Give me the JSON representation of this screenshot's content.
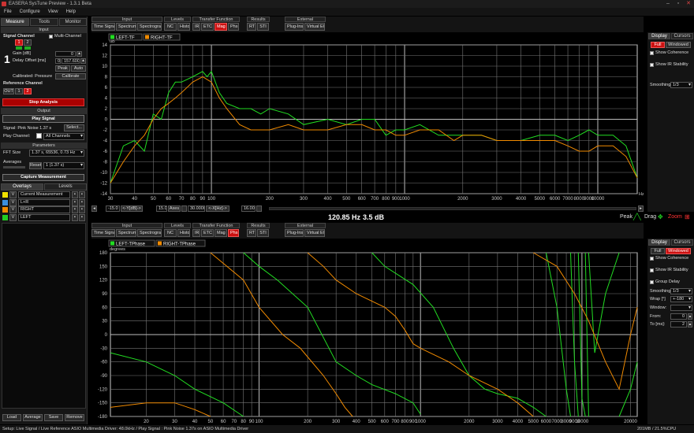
{
  "title": "EASERA SysTune Preview - 1.3.1 Beta",
  "menu": [
    "File",
    "Configure",
    "View",
    "Help"
  ],
  "left": {
    "tabs": [
      "Measure",
      "Tools",
      "Monitor"
    ],
    "input_header": "Input",
    "signal_channel": "Signal Channel",
    "multi_channel": "Multi-Channel",
    "ch1": "1",
    "ch2": "2",
    "big_channel": "1",
    "gain_label": "Gain [dB]",
    "gain_value": "0",
    "delay_label": "Delay Offset [ms]",
    "delay_value": "0",
    "delay_value2": "157.600",
    "peak": "Peak",
    "auto": "Auto",
    "calibrated": "Calibrated: Pressure",
    "calibrate": "Calibrate",
    "reference_channel": "Reference Channel",
    "ref_out": "OUT",
    "ref1": "1",
    "ref2": "2",
    "stop_analysis": "Stop Analysis",
    "output_header": "Output",
    "play_signal": "Play Signal",
    "signal_text": "Signal:  Pink Noise 1.37 s",
    "select": "Select...",
    "play_channel": "Play Channel:",
    "play_channel_value": "All Channels",
    "parameters_header": "Parameters",
    "fft_size_label": "FFT Size",
    "fft_size_value": "1.37 s, 65536, 0.73 Hz",
    "averages_label": "Averages",
    "reset": "Reset",
    "averages_value": "1 (1.37 s)",
    "capture": "Capture Measurement",
    "overlays_tab": "Overlays",
    "levels_tab": "Levels",
    "overlays": [
      {
        "v": "V",
        "name": "Current Measurement",
        "color": "#f0e000"
      },
      {
        "v": "V",
        "name": "L+R",
        "color": "#3a8fe0"
      },
      {
        "v": "V",
        "name": "RIGHT",
        "color": "#f08a00"
      },
      {
        "v": "V",
        "name": "LEFT",
        "color": "#22cc22"
      }
    ],
    "bottom_buttons": [
      "Load",
      "Average",
      "Save",
      "Remove"
    ]
  },
  "toolbar1": {
    "groups": [
      {
        "title": "Input",
        "buttons": [
          "Time Signal",
          "Spectrum",
          "Spectrogram"
        ]
      },
      {
        "title": "Levels",
        "buttons": [
          "NC",
          "Histo"
        ]
      },
      {
        "title": "Transfer Function",
        "buttons": [
          "IR",
          "ETC",
          "Mag",
          "Phs"
        ]
      },
      {
        "title": "Results",
        "buttons": [
          "RT",
          "STI"
        ]
      },
      {
        "title": "External",
        "buttons": [
          "Plug-Ins",
          "Virtual EQ"
        ]
      }
    ],
    "active": "Mag"
  },
  "toolbar2": {
    "active": "Phs"
  },
  "graph1": {
    "legend": [
      {
        "name": "LEFT-TF",
        "color": "#22dd22"
      },
      {
        "name": "RIGHT-TF",
        "color": "#f08a00"
      }
    ],
    "unit": "dB",
    "x_unit": "Hz",
    "controls": [
      "-15.0",
      "<-Y[dB]->",
      "15.0",
      "Axes",
      "",
      "30.00000",
      "<-X[Hz]->",
      "16.00k",
      ""
    ],
    "readout_freq": "120.85 Hz",
    "readout_level": "3.5 dB",
    "peak": "Peak",
    "drag": "Drag",
    "zoom": "Zoom"
  },
  "graph2": {
    "legend": [
      {
        "name": "LEFT-TPhase",
        "color": "#22dd22"
      },
      {
        "name": "RIGHT-TPhase",
        "color": "#f08a00"
      }
    ],
    "unit": "degrees"
  },
  "right1": {
    "tabs": [
      "Display",
      "Cursors"
    ],
    "full": "Full",
    "windowed": "Windowed",
    "show_coherence": "Show Coherence",
    "show_ir_stability": "Show IR Stability",
    "smoothing_label": "Smoothing",
    "smoothing_value": "1/3"
  },
  "right2": {
    "tabs": [
      "Display",
      "Cursors"
    ],
    "full": "Full",
    "windowed": "Windowed",
    "show_coherence": "Show Coherence",
    "show_ir_stability": "Show IR Stability",
    "group_delay": "Group Delay",
    "smoothing_label": "Smoothing",
    "smoothing_value": "1/3",
    "wrap_label": "Wrap [°]",
    "wrap_value": "+-180",
    "window_label": "Window:",
    "from_label": "From:",
    "from_value": "0",
    "to_label": "To [ms]:",
    "to_value": "2"
  },
  "status": "Setup: Live Signal / Live Reference ASIO Multimedia Driver: 48.0kHz / Play Signal : Pink Noise  1.37s on ASIO Multimedia Driver",
  "status_right": "201MB / 21.5%CPU",
  "colors": {
    "left": "#22dd22",
    "right": "#f08a00",
    "active_red": "#cc1111"
  },
  "chart_data": [
    {
      "type": "line",
      "x_scale": "log",
      "xlim": [
        30,
        16000
      ],
      "ylim": [
        -14,
        14
      ],
      "ylabel": "dB",
      "xlabel": "Hz",
      "x_ticks": [
        30,
        40,
        50,
        60,
        70,
        80,
        90,
        100,
        200,
        300,
        400,
        500,
        600,
        700,
        800,
        900,
        1000,
        2000,
        3000,
        4000,
        5000,
        6000,
        7000,
        8000,
        9000,
        10000
      ],
      "x_tick_labels": [
        "30",
        "40",
        "50",
        "60",
        "70",
        "80",
        "90",
        "100",
        "200",
        "300",
        "400",
        "500",
        "600",
        "700",
        "800",
        "900",
        "1000",
        "2000",
        "3000",
        "4000",
        "5000",
        "6000",
        "7000",
        "8000",
        "9000",
        "10000"
      ],
      "y_ticks": [
        14,
        12,
        10,
        8,
        6,
        4,
        2,
        0,
        -2,
        -4,
        -6,
        -8,
        -10,
        -12,
        -14
      ],
      "grid": true,
      "series": [
        {
          "name": "LEFT-TF",
          "color": "#22dd22",
          "points": [
            [
              30,
              -12
            ],
            [
              35,
              -5
            ],
            [
              40,
              -4
            ],
            [
              45,
              -6
            ],
            [
              50,
              1
            ],
            [
              55,
              0
            ],
            [
              60,
              5
            ],
            [
              65,
              7
            ],
            [
              70,
              7
            ],
            [
              80,
              8
            ],
            [
              90,
              9
            ],
            [
              95,
              8
            ],
            [
              100,
              9
            ],
            [
              110,
              5
            ],
            [
              120,
              3
            ],
            [
              140,
              2
            ],
            [
              160,
              2
            ],
            [
              180,
              1
            ],
            [
              200,
              2
            ],
            [
              250,
              1
            ],
            [
              300,
              -1
            ],
            [
              400,
              0
            ],
            [
              500,
              -1
            ],
            [
              600,
              0
            ],
            [
              700,
              0
            ],
            [
              800,
              -3
            ],
            [
              900,
              -2
            ],
            [
              1000,
              -2
            ],
            [
              1200,
              -1
            ],
            [
              1500,
              -3
            ],
            [
              1800,
              -3
            ],
            [
              2000,
              -3
            ],
            [
              2500,
              -3
            ],
            [
              3000,
              -4
            ],
            [
              4000,
              -4
            ],
            [
              5000,
              -3
            ],
            [
              6000,
              -3
            ],
            [
              7000,
              -4
            ],
            [
              8000,
              -3
            ],
            [
              9000,
              -2
            ],
            [
              10000,
              -3
            ],
            [
              12000,
              -3
            ],
            [
              14000,
              -5
            ],
            [
              16000,
              -11
            ]
          ]
        },
        {
          "name": "RIGHT-TF",
          "color": "#f08a00",
          "points": [
            [
              30,
              -12
            ],
            [
              35,
              -8
            ],
            [
              40,
              -5
            ],
            [
              45,
              -3
            ],
            [
              50,
              0
            ],
            [
              55,
              2
            ],
            [
              60,
              3
            ],
            [
              65,
              4
            ],
            [
              70,
              5
            ],
            [
              80,
              7
            ],
            [
              90,
              8
            ],
            [
              100,
              7
            ],
            [
              110,
              4
            ],
            [
              120,
              2
            ],
            [
              140,
              -1
            ],
            [
              160,
              -2
            ],
            [
              180,
              -2
            ],
            [
              200,
              -2
            ],
            [
              250,
              -1
            ],
            [
              300,
              -2
            ],
            [
              400,
              -2
            ],
            [
              500,
              -1
            ],
            [
              600,
              -1
            ],
            [
              700,
              -2
            ],
            [
              800,
              -2
            ],
            [
              900,
              -3
            ],
            [
              1000,
              -3
            ],
            [
              1200,
              -2
            ],
            [
              1500,
              -2
            ],
            [
              1800,
              -4
            ],
            [
              2000,
              -3
            ],
            [
              2500,
              -3
            ],
            [
              3000,
              -4
            ],
            [
              4000,
              -4
            ],
            [
              5000,
              -4
            ],
            [
              6000,
              -4
            ],
            [
              7000,
              -5
            ],
            [
              8000,
              -6
            ],
            [
              9000,
              -6
            ],
            [
              10000,
              -5
            ],
            [
              12000,
              -5
            ],
            [
              14000,
              -7
            ],
            [
              16000,
              -11
            ]
          ]
        }
      ]
    },
    {
      "type": "line",
      "x_scale": "log",
      "xlim": [
        12,
        22000
      ],
      "ylim": [
        -180,
        180
      ],
      "ylabel": "degrees",
      "x_ticks": [
        20,
        30,
        40,
        50,
        60,
        70,
        80,
        90,
        100,
        200,
        300,
        400,
        500,
        600,
        700,
        800,
        900,
        1000,
        2000,
        3000,
        4000,
        5000,
        6000,
        7000,
        8000,
        9000,
        10000,
        20000
      ],
      "x_tick_labels": [
        "20",
        "30",
        "40",
        "50",
        "60",
        "70",
        "80",
        "90",
        "100",
        "200",
        "300",
        "400",
        "500",
        "600",
        "700",
        "800",
        "900",
        "1000",
        "2000",
        "3000",
        "4000",
        "5000",
        "6000",
        "7000",
        "8000",
        "9000",
        "10000",
        "20000"
      ],
      "y_ticks": [
        180,
        150,
        120,
        90,
        60,
        30,
        0,
        -30,
        -60,
        -90,
        -120,
        -150,
        -180
      ],
      "grid": true,
      "series": [
        {
          "name": "LEFT-TPhase",
          "color": "#22dd22",
          "segments": [
            [
              [
                12,
                -40
              ],
              [
                20,
                -60
              ],
              [
                30,
                -90
              ],
              [
                40,
                -120
              ],
              [
                60,
                -150
              ],
              [
                80,
                -180
              ]
            ],
            [
              [
                80,
                180
              ],
              [
                100,
                150
              ],
              [
                130,
                120
              ],
              [
                200,
                60
              ],
              [
                300,
                -60
              ],
              [
                400,
                -90
              ],
              [
                500,
                -110
              ],
              [
                700,
                -130
              ],
              [
                900,
                -150
              ],
              [
                1000,
                -175
              ]
            ],
            [
              [
                500,
                180
              ],
              [
                600,
                150
              ],
              [
                900,
                110
              ],
              [
                1200,
                60
              ],
              [
                1600,
                -30
              ],
              [
                2000,
                -90
              ],
              [
                2500,
                -120
              ],
              [
                3000,
                -130
              ],
              [
                4000,
                -140
              ],
              [
                5000,
                -160
              ],
              [
                6000,
                -180
              ]
            ],
            [
              [
                6000,
                180
              ],
              [
                7000,
                60
              ],
              [
                8000,
                -120
              ],
              [
                8500,
                -180
              ]
            ],
            [
              [
                8500,
                180
              ],
              [
                9000,
                -60
              ],
              [
                9500,
                -180
              ]
            ],
            [
              [
                9500,
                180
              ],
              [
                10000,
                -140
              ],
              [
                10500,
                -180
              ]
            ],
            [
              [
                10500,
                180
              ],
              [
                11000,
                -180
              ]
            ],
            [
              [
                11000,
                180
              ],
              [
                12000,
                -40
              ],
              [
                14000,
                90
              ],
              [
                17000,
                180
              ]
            ],
            [
              [
                17000,
                -180
              ],
              [
                20000,
                -120
              ],
              [
                22000,
                -60
              ]
            ]
          ]
        },
        {
          "name": "RIGHT-TPhase",
          "color": "#f08a00",
          "segments": [
            [
              [
                12,
                -160
              ],
              [
                20,
                -150
              ],
              [
                30,
                -150
              ],
              [
                40,
                -165
              ],
              [
                50,
                -180
              ]
            ],
            [
              [
                50,
                180
              ],
              [
                80,
                120
              ],
              [
                100,
                60
              ],
              [
                140,
                0
              ],
              [
                180,
                -30
              ],
              [
                250,
                -90
              ],
              [
                300,
                -130
              ],
              [
                340,
                -160
              ],
              [
                380,
                -180
              ]
            ],
            [
              [
                200,
                180
              ],
              [
                250,
                150
              ],
              [
                300,
                120
              ],
              [
                400,
                90
              ],
              [
                600,
                60
              ],
              [
                700,
                40
              ],
              [
                800,
                10
              ],
              [
                900,
                -20
              ],
              [
                1000,
                -30
              ],
              [
                1500,
                -60
              ],
              [
                2000,
                -90
              ],
              [
                3000,
                -120
              ],
              [
                4000,
                -150
              ],
              [
                5000,
                -180
              ]
            ],
            [
              [
                5000,
                180
              ],
              [
                7000,
                150
              ],
              [
                9000,
                90
              ],
              [
                11000,
                30
              ],
              [
                14000,
                -60
              ],
              [
                17000,
                -120
              ],
              [
                20000,
                0
              ],
              [
                22000,
                60
              ]
            ]
          ]
        }
      ]
    }
  ]
}
